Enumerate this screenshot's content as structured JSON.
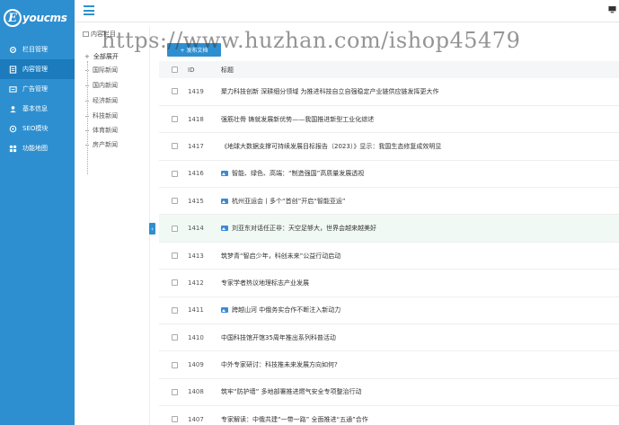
{
  "logo": {
    "mark": "E",
    "text": "youcms"
  },
  "sidebar": {
    "items": [
      {
        "label": "栏目管理",
        "icon": "gear-icon"
      },
      {
        "label": "内容管理",
        "icon": "document-icon",
        "active": true
      },
      {
        "label": "广告管理",
        "icon": "ad-icon"
      },
      {
        "label": "基本信息",
        "icon": "user-icon"
      },
      {
        "label": "SEO模块",
        "icon": "cloud-icon"
      },
      {
        "label": "功能地图",
        "icon": "map-icon"
      }
    ]
  },
  "tree": {
    "title": "内容栏目",
    "root": "全部展开",
    "children": [
      "国际新闻",
      "国内新闻",
      "经济新闻",
      "科技新闻",
      "体育新闻",
      "房产新闻"
    ]
  },
  "toolbar": {
    "add_label": "+ 发布文档"
  },
  "table": {
    "headers": {
      "id": "ID",
      "title": "标题"
    },
    "rows": [
      {
        "id": "1419",
        "title": "聚力科技创新 深耕细分领域 为推进科技自立自强稳定产业链供应链发挥更大作",
        "pic": false
      },
      {
        "id": "1418",
        "title": "强筋壮骨 铸就发展新优势——我国推进新型工业化综述",
        "pic": false
      },
      {
        "id": "1417",
        "title": "《地球大数据支撑可持续发展目标报告（2023）》显示：我国生态修复成效明显",
        "pic": false
      },
      {
        "id": "1416",
        "title": "智能、绿色、高端：“制造强国”高质量发展透视",
        "pic": true
      },
      {
        "id": "1415",
        "title": "杭州亚运会丨多个“首创”开启“智能亚运”",
        "pic": true
      },
      {
        "id": "1414",
        "title": "刘亚东对话任正非：天空足够大，世界会越来越美好",
        "pic": true,
        "highlight": true
      },
      {
        "id": "1413",
        "title": "筑梦青“智启少年，科创未来”公益行动启动",
        "pic": false
      },
      {
        "id": "1412",
        "title": "专家学者热议地理标志产业发展",
        "pic": false
      },
      {
        "id": "1411",
        "title": "跨越山河 中俄务实合作不断注入新动力",
        "pic": true
      },
      {
        "id": "1410",
        "title": "中国科技馆开馆35周年推出系列科普活动",
        "pic": false
      },
      {
        "id": "1409",
        "title": "中外专家研讨：科技推未来发展方向如何?",
        "pic": false
      },
      {
        "id": "1408",
        "title": "筑牢“防护墙” 多地部署推进燃气安全专项整治行动",
        "pic": false
      },
      {
        "id": "1407",
        "title": "专家解读：中俄共建“一带一路” 全面推进“五通”合作",
        "pic": false
      }
    ]
  },
  "watermark": "https://www.huzhan.com/ishop45479",
  "colors": {
    "sidebar": "#2e8fd0",
    "sidebar_active": "#1b7bbd",
    "row_highlight": "#f1f9f5"
  }
}
